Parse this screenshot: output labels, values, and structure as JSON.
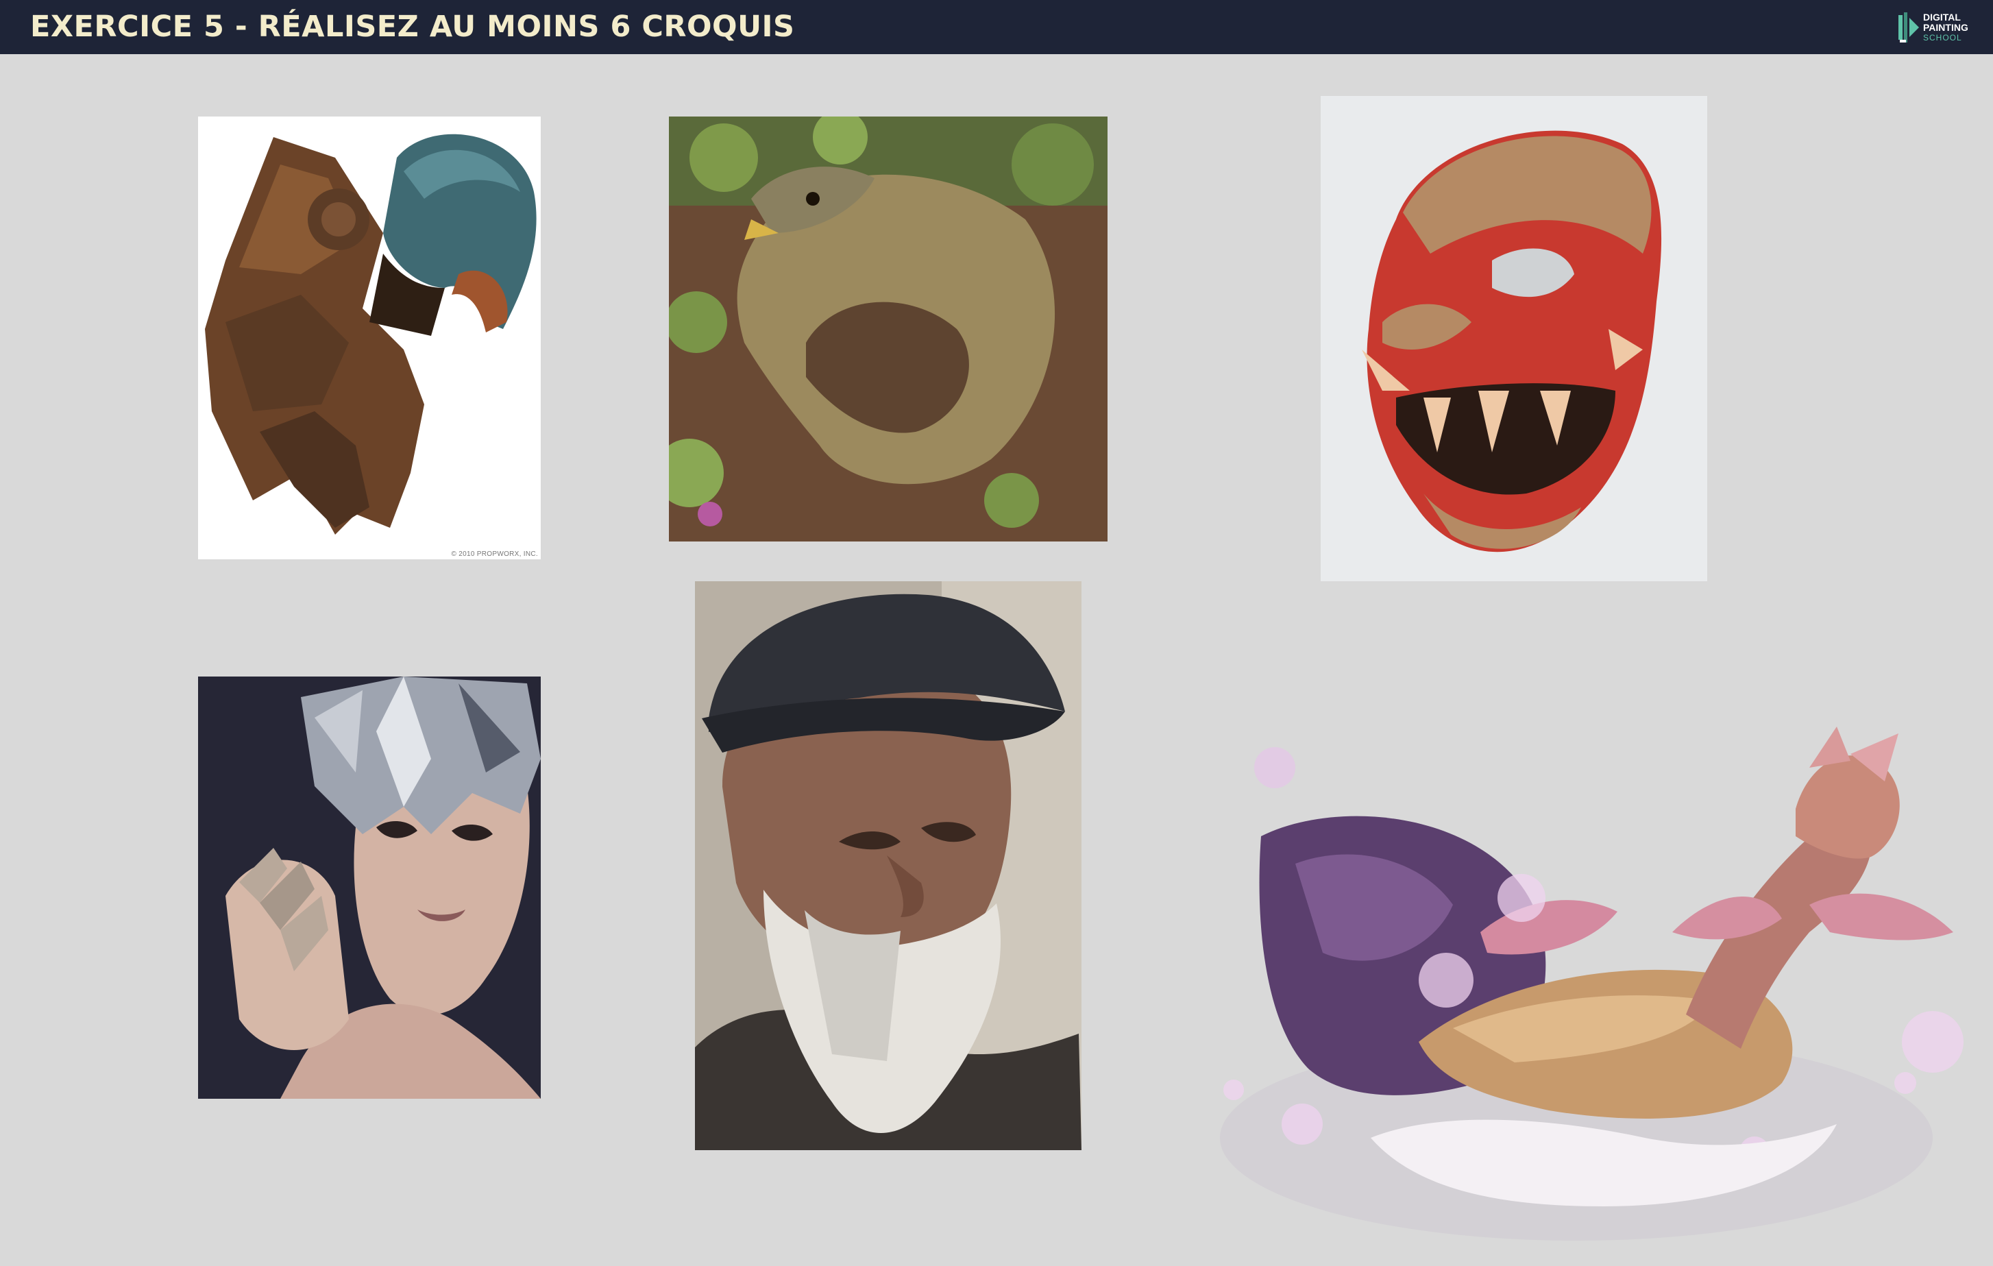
{
  "header": {
    "title": "EXERCICE 5 - RÉALISEZ AU MOINS 6 CROQUIS",
    "logo": {
      "line1": "DIGITAL",
      "line2": "PAINTING",
      "line3": "SCHOOL"
    },
    "background": "#1e2437",
    "title_color": "#f3eccb",
    "accent": "#5fc3a9"
  },
  "page": {
    "background": "#d9d9d9"
  },
  "references": [
    {
      "subject": "bird-warrior-helmet",
      "caption": "© 2010 PROPWORX, INC."
    },
    {
      "subject": "armadillo-lizard"
    },
    {
      "subject": "oni-mask"
    },
    {
      "subject": "woman-with-mirror-mask"
    },
    {
      "subject": "old-man-portrait"
    },
    {
      "subject": "water-dragon-creature"
    }
  ]
}
